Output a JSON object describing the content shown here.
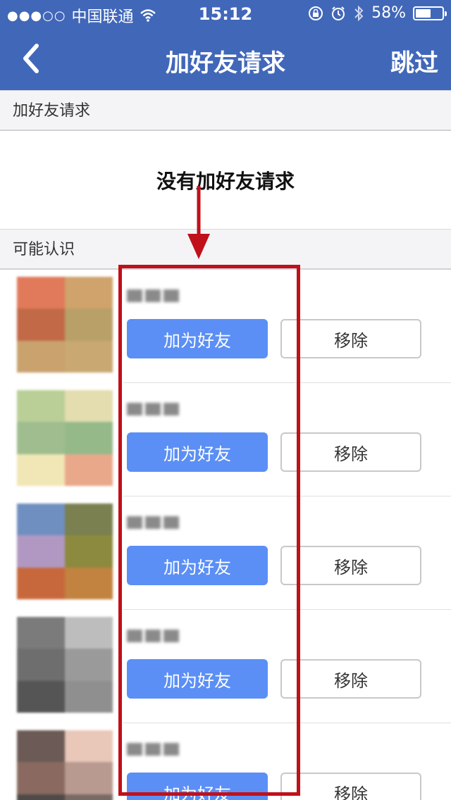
{
  "status_bar": {
    "signal_dots": "●●●○○",
    "carrier": "中国联通",
    "time": "15:12",
    "battery_percent": "58%",
    "battery_level": 0.58
  },
  "nav": {
    "back_icon": "chevron-left-icon",
    "title": "加好友请求",
    "skip_label": "跳过"
  },
  "friend_requests": {
    "header": "加好友请求",
    "empty_message": "没有加好友请求"
  },
  "suggestions": {
    "header": "可能认识",
    "add_label": "加为好友",
    "remove_label": "移除",
    "items": [
      {
        "avatar_colors": [
          "#e07a5a",
          "#cfa36b",
          "#c26a48",
          "#b8a068",
          "#c9a26e",
          "#c9a872"
        ]
      },
      {
        "avatar_colors": [
          "#b9cf97",
          "#e3ddb0",
          "#9fbd8e",
          "#96b98a",
          "#f1e6b5",
          "#e9a88a"
        ]
      },
      {
        "avatar_colors": [
          "#6f8fc0",
          "#7a8050",
          "#b198c2",
          "#8c8a3e",
          "#c7683c",
          "#c28240"
        ]
      },
      {
        "avatar_colors": [
          "#7b7b7b",
          "#bdbdbd",
          "#6e6e6e",
          "#9a9a9a",
          "#555555",
          "#8f8f8f"
        ]
      },
      {
        "avatar_colors": [
          "#6b5a55",
          "#e9c7b9",
          "#8a6a60",
          "#b89a90",
          "#4f4a48",
          "#7a6a66"
        ]
      }
    ]
  },
  "annotation_color": "#c0101a"
}
